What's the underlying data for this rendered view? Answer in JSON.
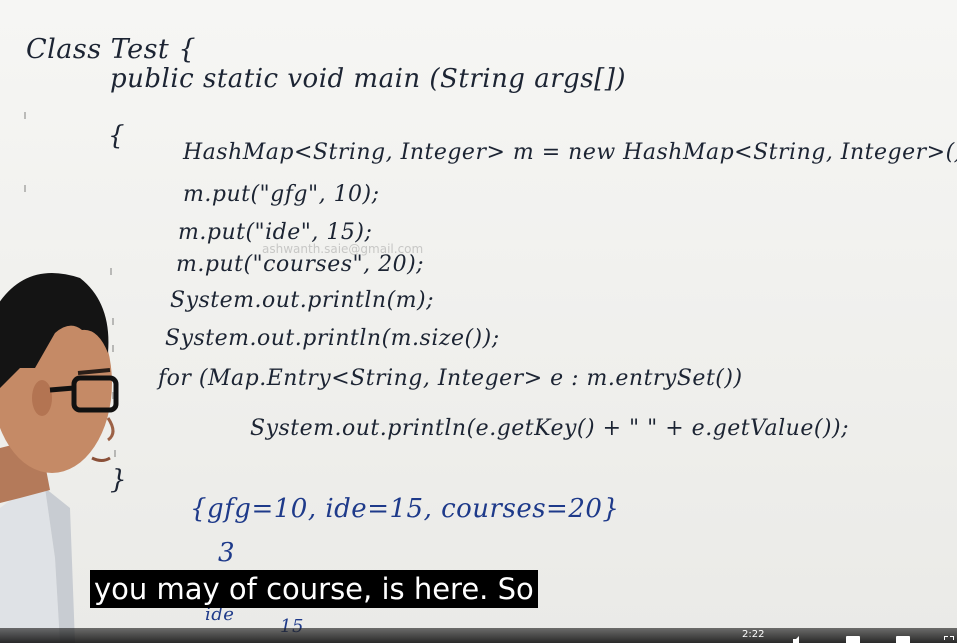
{
  "board": {
    "lines": [
      "Class Test {",
      "public static void main (String args[])",
      "{",
      "HashMap<String, Integer> m = new HashMap<String, Integer>();",
      "m.put(\"gfg\", 10);",
      "m.put(\"ide\", 15);",
      "m.put(\"courses\", 20);",
      "System.out.println(m);",
      "System.out.println(m.size());",
      "for (Map.Entry<String, Integer> e : m.entrySet())",
      "System.out.println(e.getKey() + \" \" + e.getValue());",
      "}"
    ],
    "output_lines": [
      "{gfg=10, ide=15, courses=20}",
      "3",
      "ide",
      "15"
    ],
    "watermark": "ashwanth.saie@gmail.com"
  },
  "caption": "you may of course, is here. So",
  "player": {
    "time": "2:22"
  },
  "colors": {
    "ink": "#1c2433",
    "output_ink": "#1e3a8a",
    "caption_bg": "#000000"
  }
}
